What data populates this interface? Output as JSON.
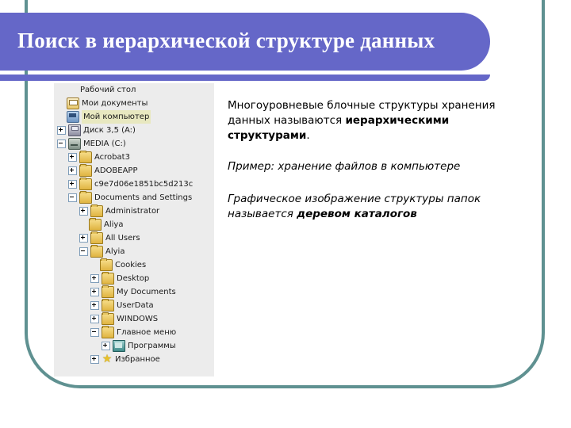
{
  "slide": {
    "title": "Поиск в иерархической структуре данных",
    "colors": {
      "banner_purple": "#6567c8",
      "frame_teal": "#5f9191",
      "panel_gray": "#ececec",
      "selection_highlight": "#e8e8c0"
    }
  },
  "explorer": {
    "rows": [
      {
        "label": "Рабочий стол",
        "indent": 0,
        "expander": "none",
        "icon": "none",
        "selected": false
      },
      {
        "label": "Мои документы",
        "indent": 0,
        "expander": "none",
        "icon": "documents-icon",
        "selected": false
      },
      {
        "label": "Мой компьютер",
        "indent": 0,
        "expander": "none",
        "icon": "computer-icon",
        "selected": true
      },
      {
        "label": "Диск 3,5 (A:)",
        "indent": 0,
        "expander": "plus",
        "icon": "floppy-icon",
        "selected": false
      },
      {
        "label": "MEDIA (C:)",
        "indent": 0,
        "expander": "minus",
        "icon": "drive-icon",
        "selected": false
      },
      {
        "label": "Acrobat3",
        "indent": 1,
        "expander": "plus",
        "icon": "folder-icon",
        "selected": false
      },
      {
        "label": "ADOBEAPP",
        "indent": 1,
        "expander": "plus",
        "icon": "folder-icon",
        "selected": false
      },
      {
        "label": "c9e7d06e1851bc5d213c",
        "indent": 1,
        "expander": "plus",
        "icon": "folder-icon",
        "selected": false
      },
      {
        "label": "Documents and Settings",
        "indent": 1,
        "expander": "minus",
        "icon": "folder-icon",
        "selected": false
      },
      {
        "label": "Administrator",
        "indent": 2,
        "expander": "plus",
        "icon": "folder-icon",
        "selected": false
      },
      {
        "label": "Aliya",
        "indent": 2,
        "expander": "none",
        "icon": "folder-icon",
        "selected": false
      },
      {
        "label": "All Users",
        "indent": 2,
        "expander": "plus",
        "icon": "folder-icon",
        "selected": false
      },
      {
        "label": "Alyia",
        "indent": 2,
        "expander": "minus",
        "icon": "folder-icon",
        "selected": false
      },
      {
        "label": "Cookies",
        "indent": 3,
        "expander": "none",
        "icon": "folder-icon",
        "selected": false
      },
      {
        "label": "Desktop",
        "indent": 3,
        "expander": "plus",
        "icon": "folder-icon",
        "selected": false
      },
      {
        "label": "My Documents",
        "indent": 3,
        "expander": "plus",
        "icon": "folder-icon",
        "selected": false
      },
      {
        "label": "UserData",
        "indent": 3,
        "expander": "plus",
        "icon": "folder-icon",
        "selected": false
      },
      {
        "label": "WINDOWS",
        "indent": 3,
        "expander": "plus",
        "icon": "folder-icon",
        "selected": false
      },
      {
        "label": "Главное меню",
        "indent": 3,
        "expander": "minus",
        "icon": "folder-icon",
        "selected": false
      },
      {
        "label": "Программы",
        "indent": 4,
        "expander": "plus",
        "icon": "programs-folder-icon",
        "selected": false
      },
      {
        "label": "Избранное",
        "indent": 3,
        "expander": "plus",
        "icon": "star-icon",
        "selected": false
      }
    ]
  },
  "body": {
    "p1_part1": "Многоуровневые блочные структуры хранения данных называются ",
    "p1_bold": "иерархическими структурами",
    "p1_part2": ".",
    "p2": "Пример: хранение файлов в компьютере",
    "p3_part1": "Графическое изображение структуры папок называется ",
    "p3_bold": "деревом каталогов"
  }
}
